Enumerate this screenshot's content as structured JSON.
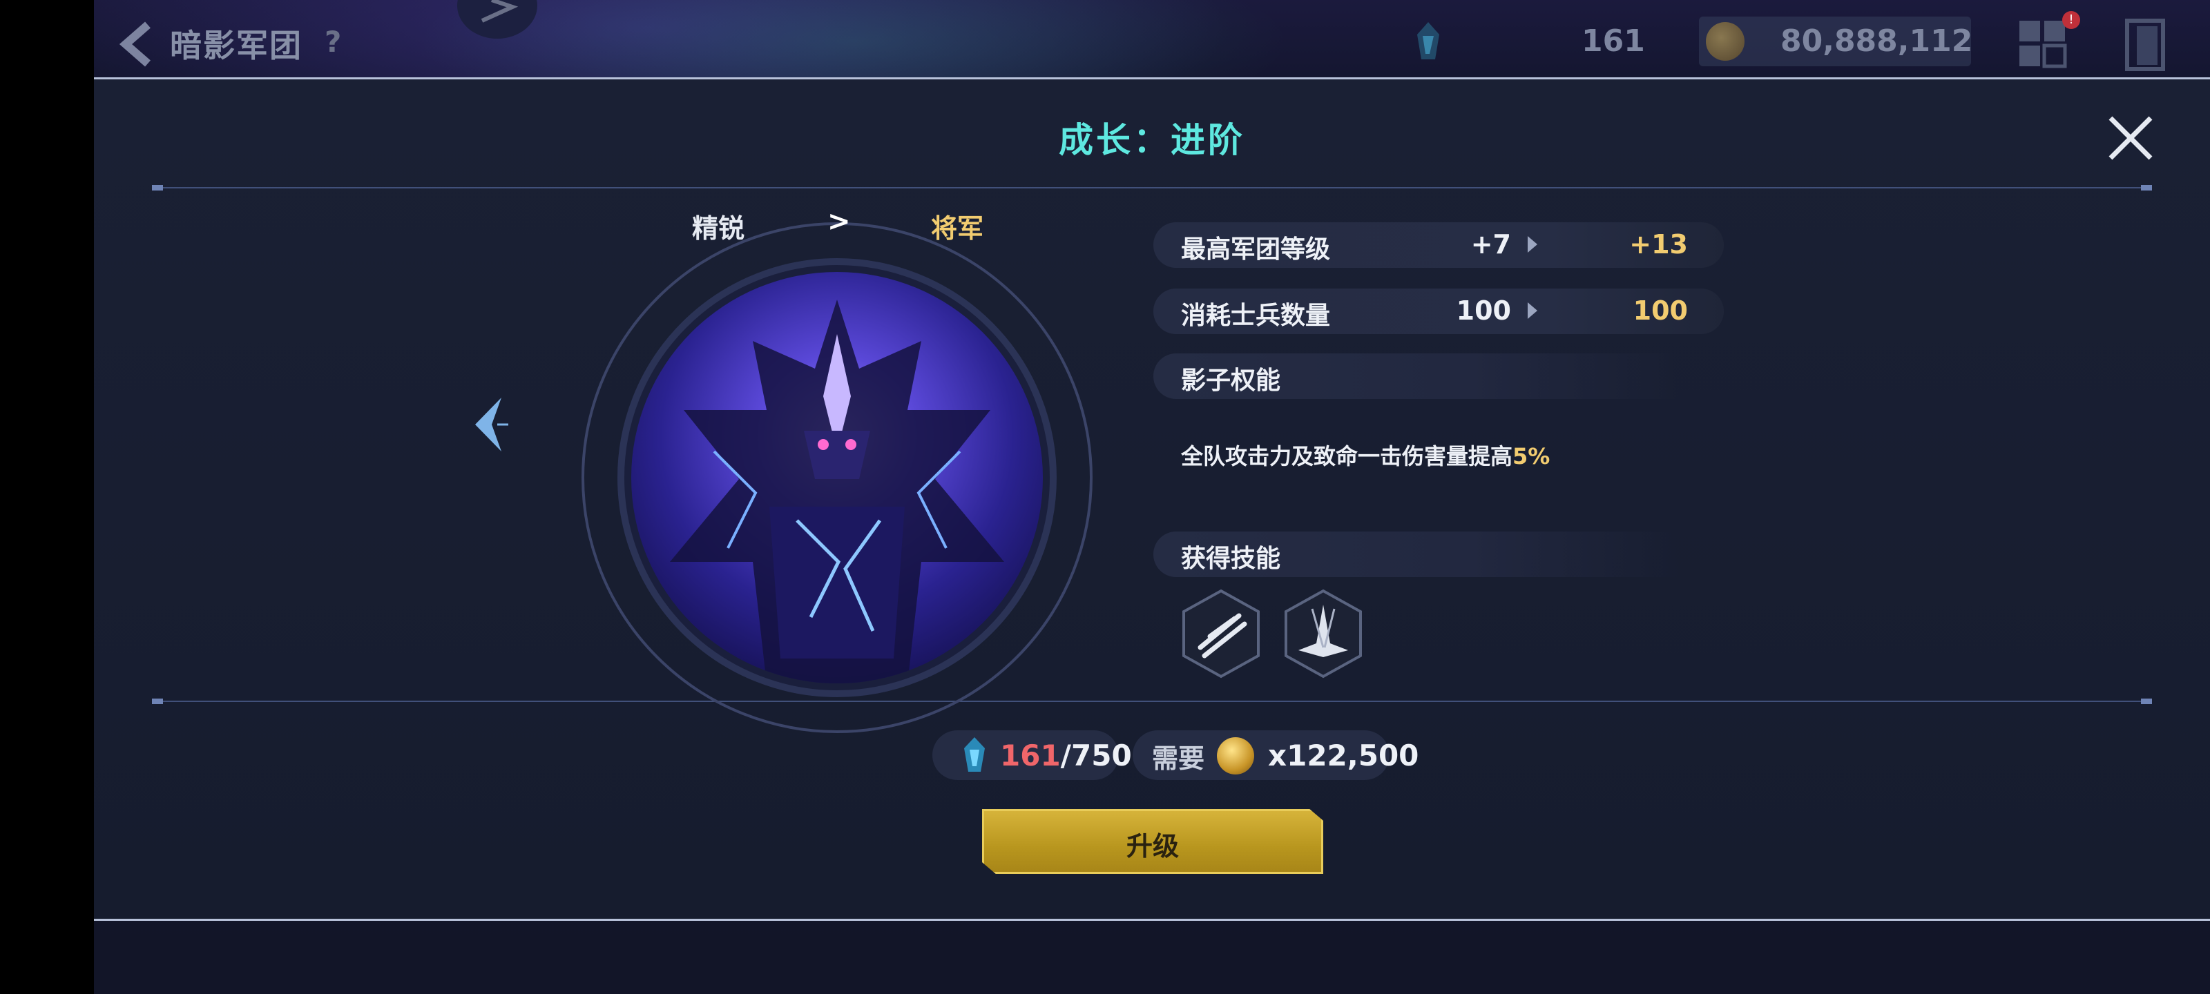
{
  "header": {
    "title": "暗影军团",
    "help": "?",
    "soldier_count": "161",
    "gold_count": "80,888,112",
    "notification_badge": "!"
  },
  "modal": {
    "title": "成长：进阶",
    "rank": {
      "from": "精锐",
      "to": "将军"
    },
    "stats": [
      {
        "label": "最高军团等级",
        "old": "+7",
        "new": "+13"
      },
      {
        "label": "消耗士兵数量",
        "old": "100",
        "new": "100"
      }
    ],
    "shadow_power": {
      "heading": "影子权能",
      "description_prefix": "全队攻击力及致命一击伤害量提高",
      "description_value": "5%"
    },
    "skills": {
      "heading": "获得技能",
      "icons": [
        "claw-slash-skill-icon",
        "ground-burst-skill-icon"
      ]
    },
    "cost": {
      "soldiers_current": "161",
      "soldiers_sep": "/750",
      "need_label": "需要",
      "gold_amount": "x122,500"
    },
    "upgrade_label": "升级"
  },
  "colors": {
    "accent_title": "#5ee8e0",
    "gold_text": "#f2cc70",
    "insufficient": "#f0666a",
    "button_gold": "#c9a62c"
  }
}
